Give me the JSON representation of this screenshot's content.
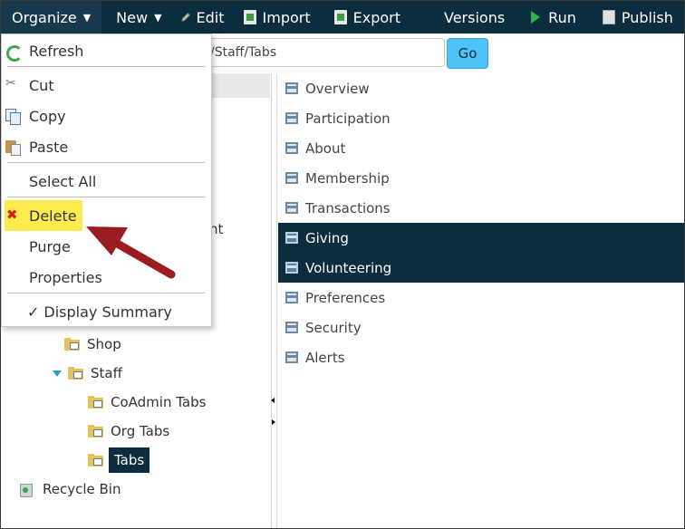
{
  "toolbar": {
    "organize": "Organize",
    "new": "New",
    "edit": "Edit",
    "import": "Import",
    "export": "Export",
    "versions": "Versions",
    "run": "Run",
    "publish": "Publish"
  },
  "address": {
    "path": "/Staff/Tabs",
    "go": "Go"
  },
  "menu": {
    "items": [
      {
        "label": "Refresh",
        "icon": "refresh-icon"
      },
      {
        "label": "Cut",
        "icon": "scissors-icon"
      },
      {
        "label": "Copy",
        "icon": "copy-icon"
      },
      {
        "label": "Paste",
        "icon": "paste-icon"
      },
      {
        "label": "Select All"
      },
      {
        "label": "Delete",
        "icon": "delete-x-icon",
        "highlight": "#ffeb4d"
      },
      {
        "label": "Purge"
      },
      {
        "label": "Properties"
      },
      {
        "label": "Display Summary",
        "checked": true,
        "check": "✓"
      }
    ]
  },
  "tree": {
    "partial_text": "nt",
    "items": [
      {
        "label": "Shop"
      },
      {
        "label": "Staff",
        "expanded": true
      },
      {
        "label": "CoAdmin Tabs"
      },
      {
        "label": "Org Tabs"
      },
      {
        "label": "Tabs",
        "selected": true
      },
      {
        "label": "Recycle Bin"
      }
    ]
  },
  "list": {
    "items": [
      {
        "label": "Overview"
      },
      {
        "label": "Participation"
      },
      {
        "label": "About"
      },
      {
        "label": "Membership"
      },
      {
        "label": "Transactions"
      },
      {
        "label": "Giving",
        "selected": true
      },
      {
        "label": "Volunteering",
        "selected": true
      },
      {
        "label": "Preferences"
      },
      {
        "label": "Security"
      },
      {
        "label": "Alerts"
      }
    ]
  },
  "colors": {
    "toolbar_bg": "#0b2d3e",
    "selection_bg": "#0b2d3e",
    "go_button": "#4fc3f7",
    "delete_highlight": "#ffeb4d",
    "annotation_arrow": "#9b1c20"
  }
}
